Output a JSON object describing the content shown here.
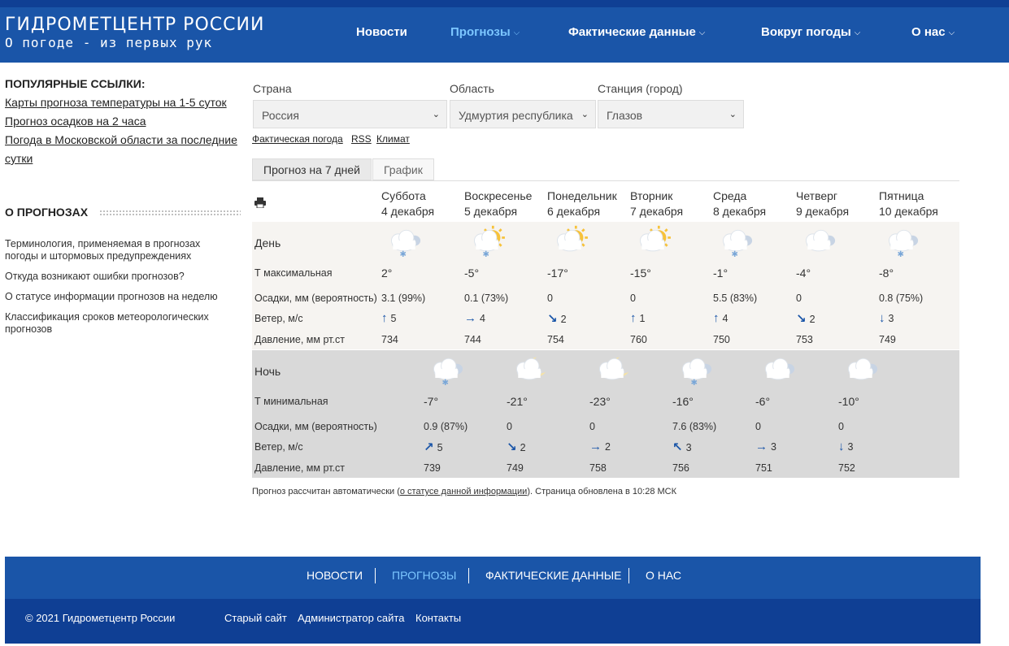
{
  "header": {
    "title": "ГИДРОМЕТЦЕНТР РОССИИ",
    "subtitle": "О погоде - из первых рук",
    "nav": [
      {
        "label": "Новости",
        "dropdown": false
      },
      {
        "label": "Прогнозы",
        "dropdown": true
      },
      {
        "label": "Фактические данные",
        "dropdown": true
      },
      {
        "label": "Вокруг погоды",
        "dropdown": true
      },
      {
        "label": "О нас",
        "dropdown": true
      }
    ],
    "active_color": "#7cc6ff",
    "bg_color": "#1a55a8"
  },
  "sidebar": {
    "popular_title": "ПОПУЛЯРНЫЕ ССЫЛКИ:",
    "popular_links": [
      "Карты прогноза температуры на 1-5 суток",
      "Прогноз осадков на 2 часа",
      "Погода в Московской области за последние сутки"
    ],
    "about_title": "О ПРОГНОЗАХ",
    "about_items": [
      "Терминология, применяемая в прогнозах погоды и штормовых предупреждениях",
      "Откуда возникают ошибки прогнозов?",
      "О статусе информации прогнозов на неделю",
      "Классификация сроков метеорологических прогнозов"
    ]
  },
  "filters": {
    "country_label": "Страна",
    "country_value": "Россия",
    "region_label": "Область",
    "region_value": "Удмуртия республика",
    "station_label": "Станция (город)",
    "station_value": "Глазов",
    "links": [
      "Фактическая погода",
      "RSS",
      "Климат"
    ]
  },
  "tabs": [
    "Прогноз на 7 дней",
    "График"
  ],
  "forecast": {
    "days": [
      {
        "name": "Суббота",
        "date": "4 декабря"
      },
      {
        "name": "Воскресенье",
        "date": "5 декабря"
      },
      {
        "name": "Понедельник",
        "date": "6 декабря"
      },
      {
        "name": "Вторник",
        "date": "7 декабря"
      },
      {
        "name": "Среда",
        "date": "8 декабря"
      },
      {
        "name": "Четверг",
        "date": "9 декабря"
      },
      {
        "name": "Пятница",
        "date": "10 декабря"
      }
    ],
    "day_labels": {
      "title": "День",
      "temp": "Т максимальная",
      "precip": "Осадки, мм (вероятность)",
      "wind": "Ветер, м/с",
      "pressure": "Давление, мм рт.ст"
    },
    "night_labels": {
      "title": "Ночь",
      "temp": "Т минимальная",
      "precip": "Осадки, мм (вероятность)",
      "wind": "Ветер, м/с",
      "pressure": "Давление, мм рт.ст"
    },
    "day": [
      {
        "icon": "cloud-snow-icon",
        "temp": "2°",
        "precip": "3.1 (99%)",
        "wind_dir": "↑",
        "wind": "5",
        "pressure": "734"
      },
      {
        "icon": "sun-cloud-snow-icon",
        "temp": "-5°",
        "precip": "0.1 (73%)",
        "wind_dir": "→",
        "wind": "4",
        "pressure": "744"
      },
      {
        "icon": "sun-cloud-icon",
        "temp": "-17°",
        "precip": "0",
        "wind_dir": "↘",
        "wind": "2",
        "pressure": "754"
      },
      {
        "icon": "sun-cloud-icon",
        "temp": "-15°",
        "precip": "0",
        "wind_dir": "↑",
        "wind": "1",
        "pressure": "760"
      },
      {
        "icon": "cloud-snow-icon",
        "temp": "-1°",
        "precip": "5.5 (83%)",
        "wind_dir": "↑",
        "wind": "4",
        "pressure": "750"
      },
      {
        "icon": "cloud-icon",
        "temp": "-4°",
        "precip": "0",
        "wind_dir": "↘",
        "wind": "2",
        "pressure": "753"
      },
      {
        "icon": "cloud-snow-icon",
        "temp": "-8°",
        "precip": "0.8 (75%)",
        "wind_dir": "↓",
        "wind": "3",
        "pressure": "749"
      }
    ],
    "night": [
      {
        "icon": "cloud-snow-icon",
        "temp": "-7°",
        "precip": "0.9 (87%)",
        "wind_dir": "↗",
        "wind": "5",
        "pressure": "739"
      },
      {
        "icon": "moon-cloud-icon",
        "temp": "-21°",
        "precip": "0",
        "wind_dir": "↘",
        "wind": "2",
        "pressure": "749"
      },
      {
        "icon": "moon-cloud-icon",
        "temp": "-23°",
        "precip": "0",
        "wind_dir": "→",
        "wind": "2",
        "pressure": "758"
      },
      {
        "icon": "cloud-snow-icon",
        "temp": "-16°",
        "precip": "7.6 (83%)",
        "wind_dir": "↖",
        "wind": "3",
        "pressure": "756"
      },
      {
        "icon": "cloud-icon",
        "temp": "-6°",
        "precip": "0",
        "wind_dir": "→",
        "wind": "3",
        "pressure": "751"
      },
      {
        "icon": "cloud-icon",
        "temp": "-10°",
        "precip": "0",
        "wind_dir": "↓",
        "wind": "3",
        "pressure": "752"
      }
    ],
    "note_prefix": "Прогноз рассчитан автоматически (",
    "note_link": "о статусе данной информации",
    "note_suffix": "). Страница обновлена в 10:28 МСК"
  },
  "footer": {
    "nav": [
      "НОВОСТИ",
      "ПРОГНОЗЫ",
      "ФАКТИЧЕСКИЕ ДАННЫЕ",
      "О НАС"
    ],
    "copyright": "© 2021 Гидрометцентр России",
    "links": [
      "Старый сайт",
      "Администратор сайта",
      "Контакты"
    ]
  }
}
